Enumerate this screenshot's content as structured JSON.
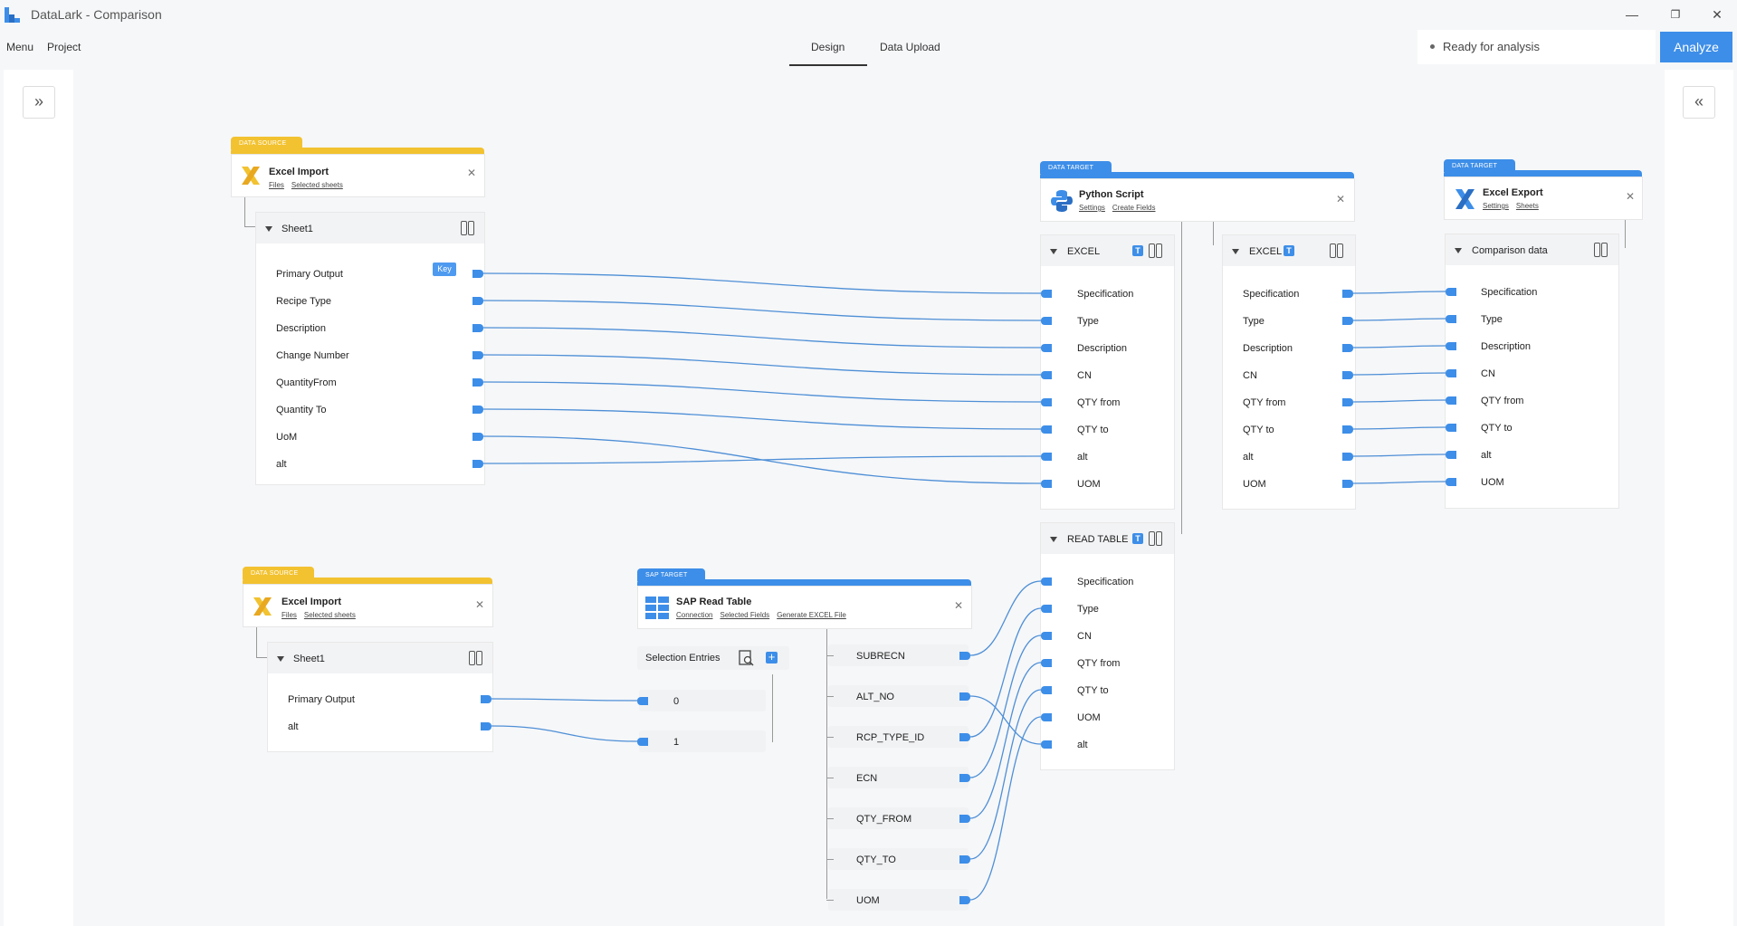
{
  "window": {
    "title": "DataLark - Comparison",
    "minimize": "—",
    "restore": "❐",
    "close": "✕"
  },
  "menu": {
    "items": [
      "Menu",
      "Project"
    ]
  },
  "tabs": [
    "Design",
    "Data Upload"
  ],
  "status": {
    "text": "Ready for analysis",
    "action": "Analyze"
  },
  "rails": {
    "expand": "»",
    "collapse": "«"
  },
  "colors": {
    "accent": "#3d8ee8",
    "source": "#f2c230"
  },
  "sources": [
    {
      "kind": "DATA SOURCE",
      "title": "Excel Import",
      "links": [
        "Files",
        "Selected sheets"
      ],
      "sheet": "Sheet1",
      "key": "Key",
      "fields": [
        "Primary Output",
        "Recipe Type",
        "Description",
        "Change Number",
        "QuantityFrom",
        "Quantity To",
        "UoM",
        "alt"
      ]
    },
    {
      "kind": "DATA SOURCE",
      "title": "Excel Import",
      "links": [
        "Files",
        "Selected sheets"
      ],
      "sheet": "Sheet1",
      "fields": [
        "Primary Output",
        "alt"
      ]
    }
  ],
  "sap": {
    "kind": "SAP TARGET",
    "title": "SAP Read Table",
    "links": [
      "Connection",
      "Selected Fields",
      "Generate EXCEL File"
    ],
    "selection": {
      "label": "Selection Entries",
      "entries": [
        "0",
        "1"
      ]
    },
    "outputs": [
      "SUBRECN",
      "ALT_NO",
      "RCP_TYPE_ID",
      "ECN",
      "QTY_FROM",
      "QTY_TO",
      "UOM"
    ]
  },
  "python": {
    "kind": "DATA TARGET",
    "title": "Python Script",
    "links": [
      "Settings",
      "Create Fields"
    ],
    "excel_in": {
      "title": "EXCEL",
      "badge": "T",
      "fields": [
        "Specification",
        "Type",
        "Description",
        "CN",
        "QTY from",
        "QTY to",
        "alt",
        "UOM"
      ]
    },
    "read_table": {
      "title": "READ TABLE",
      "badge": "T",
      "fields": [
        "Specification",
        "Type",
        "CN",
        "QTY from",
        "QTY to",
        "UOM",
        "alt"
      ]
    },
    "excel_out": {
      "title": "EXCEL",
      "badge": "T",
      "fields": [
        "Specification",
        "Type",
        "Description",
        "CN",
        "QTY from",
        "QTY to",
        "alt",
        "UOM"
      ]
    }
  },
  "export": {
    "kind": "DATA TARGET",
    "title": "Excel Export",
    "links": [
      "Settings",
      "Sheets"
    ],
    "sheet": "Comparison data",
    "fields": [
      "Specification",
      "Type",
      "Description",
      "CN",
      "QTY from",
      "QTY to",
      "alt",
      "UOM"
    ]
  }
}
